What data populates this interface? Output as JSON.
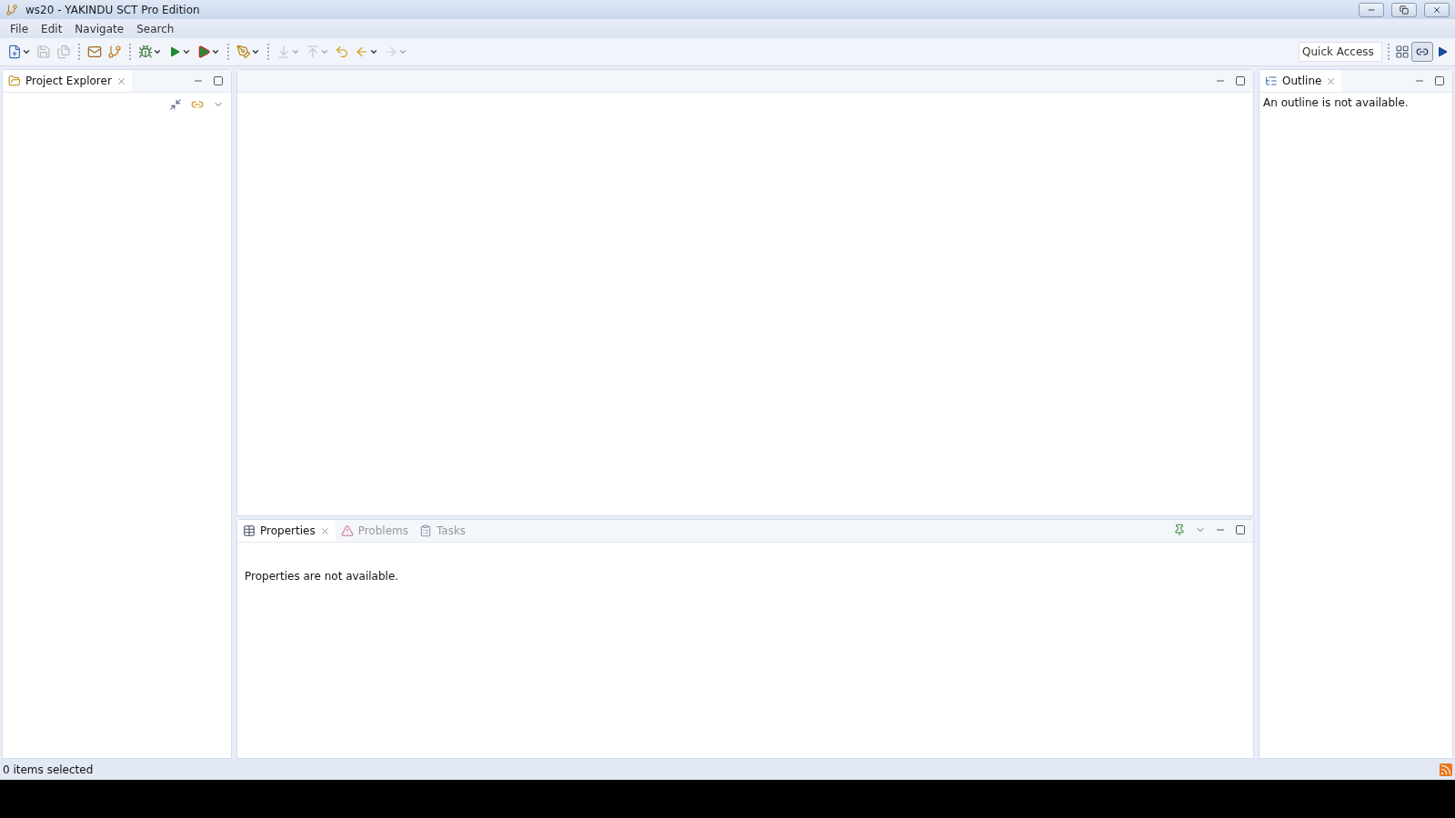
{
  "window": {
    "title": "ws20 - YAKINDU SCT Pro Edition"
  },
  "menu": [
    "File",
    "Edit",
    "Navigate",
    "Search"
  ],
  "toolbar": [
    {
      "kind": "new",
      "disabled": false,
      "dropdown": true
    },
    {
      "kind": "save",
      "disabled": true,
      "dropdown": false
    },
    {
      "kind": "save-all",
      "disabled": true,
      "dropdown": false
    },
    {
      "kind": "sep"
    },
    {
      "kind": "mail",
      "disabled": false,
      "dropdown": false
    },
    {
      "kind": "branch",
      "disabled": false,
      "dropdown": false
    },
    {
      "kind": "sep"
    },
    {
      "kind": "bug",
      "disabled": false,
      "dropdown": true
    },
    {
      "kind": "run",
      "disabled": false,
      "dropdown": true
    },
    {
      "kind": "run-tools",
      "disabled": false,
      "dropdown": true
    },
    {
      "kind": "sep"
    },
    {
      "kind": "pen",
      "disabled": false,
      "dropdown": true
    },
    {
      "kind": "sep"
    },
    {
      "kind": "down",
      "disabled": true,
      "dropdown": true
    },
    {
      "kind": "up",
      "disabled": true,
      "dropdown": true
    },
    {
      "kind": "last-edit",
      "disabled": false,
      "dropdown": false
    },
    {
      "kind": "back",
      "disabled": false,
      "dropdown": true
    },
    {
      "kind": "forward",
      "disabled": true,
      "dropdown": true
    }
  ],
  "quick_access": {
    "placeholder": "Quick Access"
  },
  "project_explorer": {
    "tab": "Project Explorer"
  },
  "outline": {
    "tab": "Outline",
    "message": "An outline is not available."
  },
  "bottom_panel": {
    "tabs": [
      {
        "label": "Properties",
        "selected": true
      },
      {
        "label": "Problems",
        "selected": false
      },
      {
        "label": "Tasks",
        "selected": false
      }
    ],
    "message": "Properties are not available."
  },
  "status_bar": {
    "text": "0 items selected"
  }
}
